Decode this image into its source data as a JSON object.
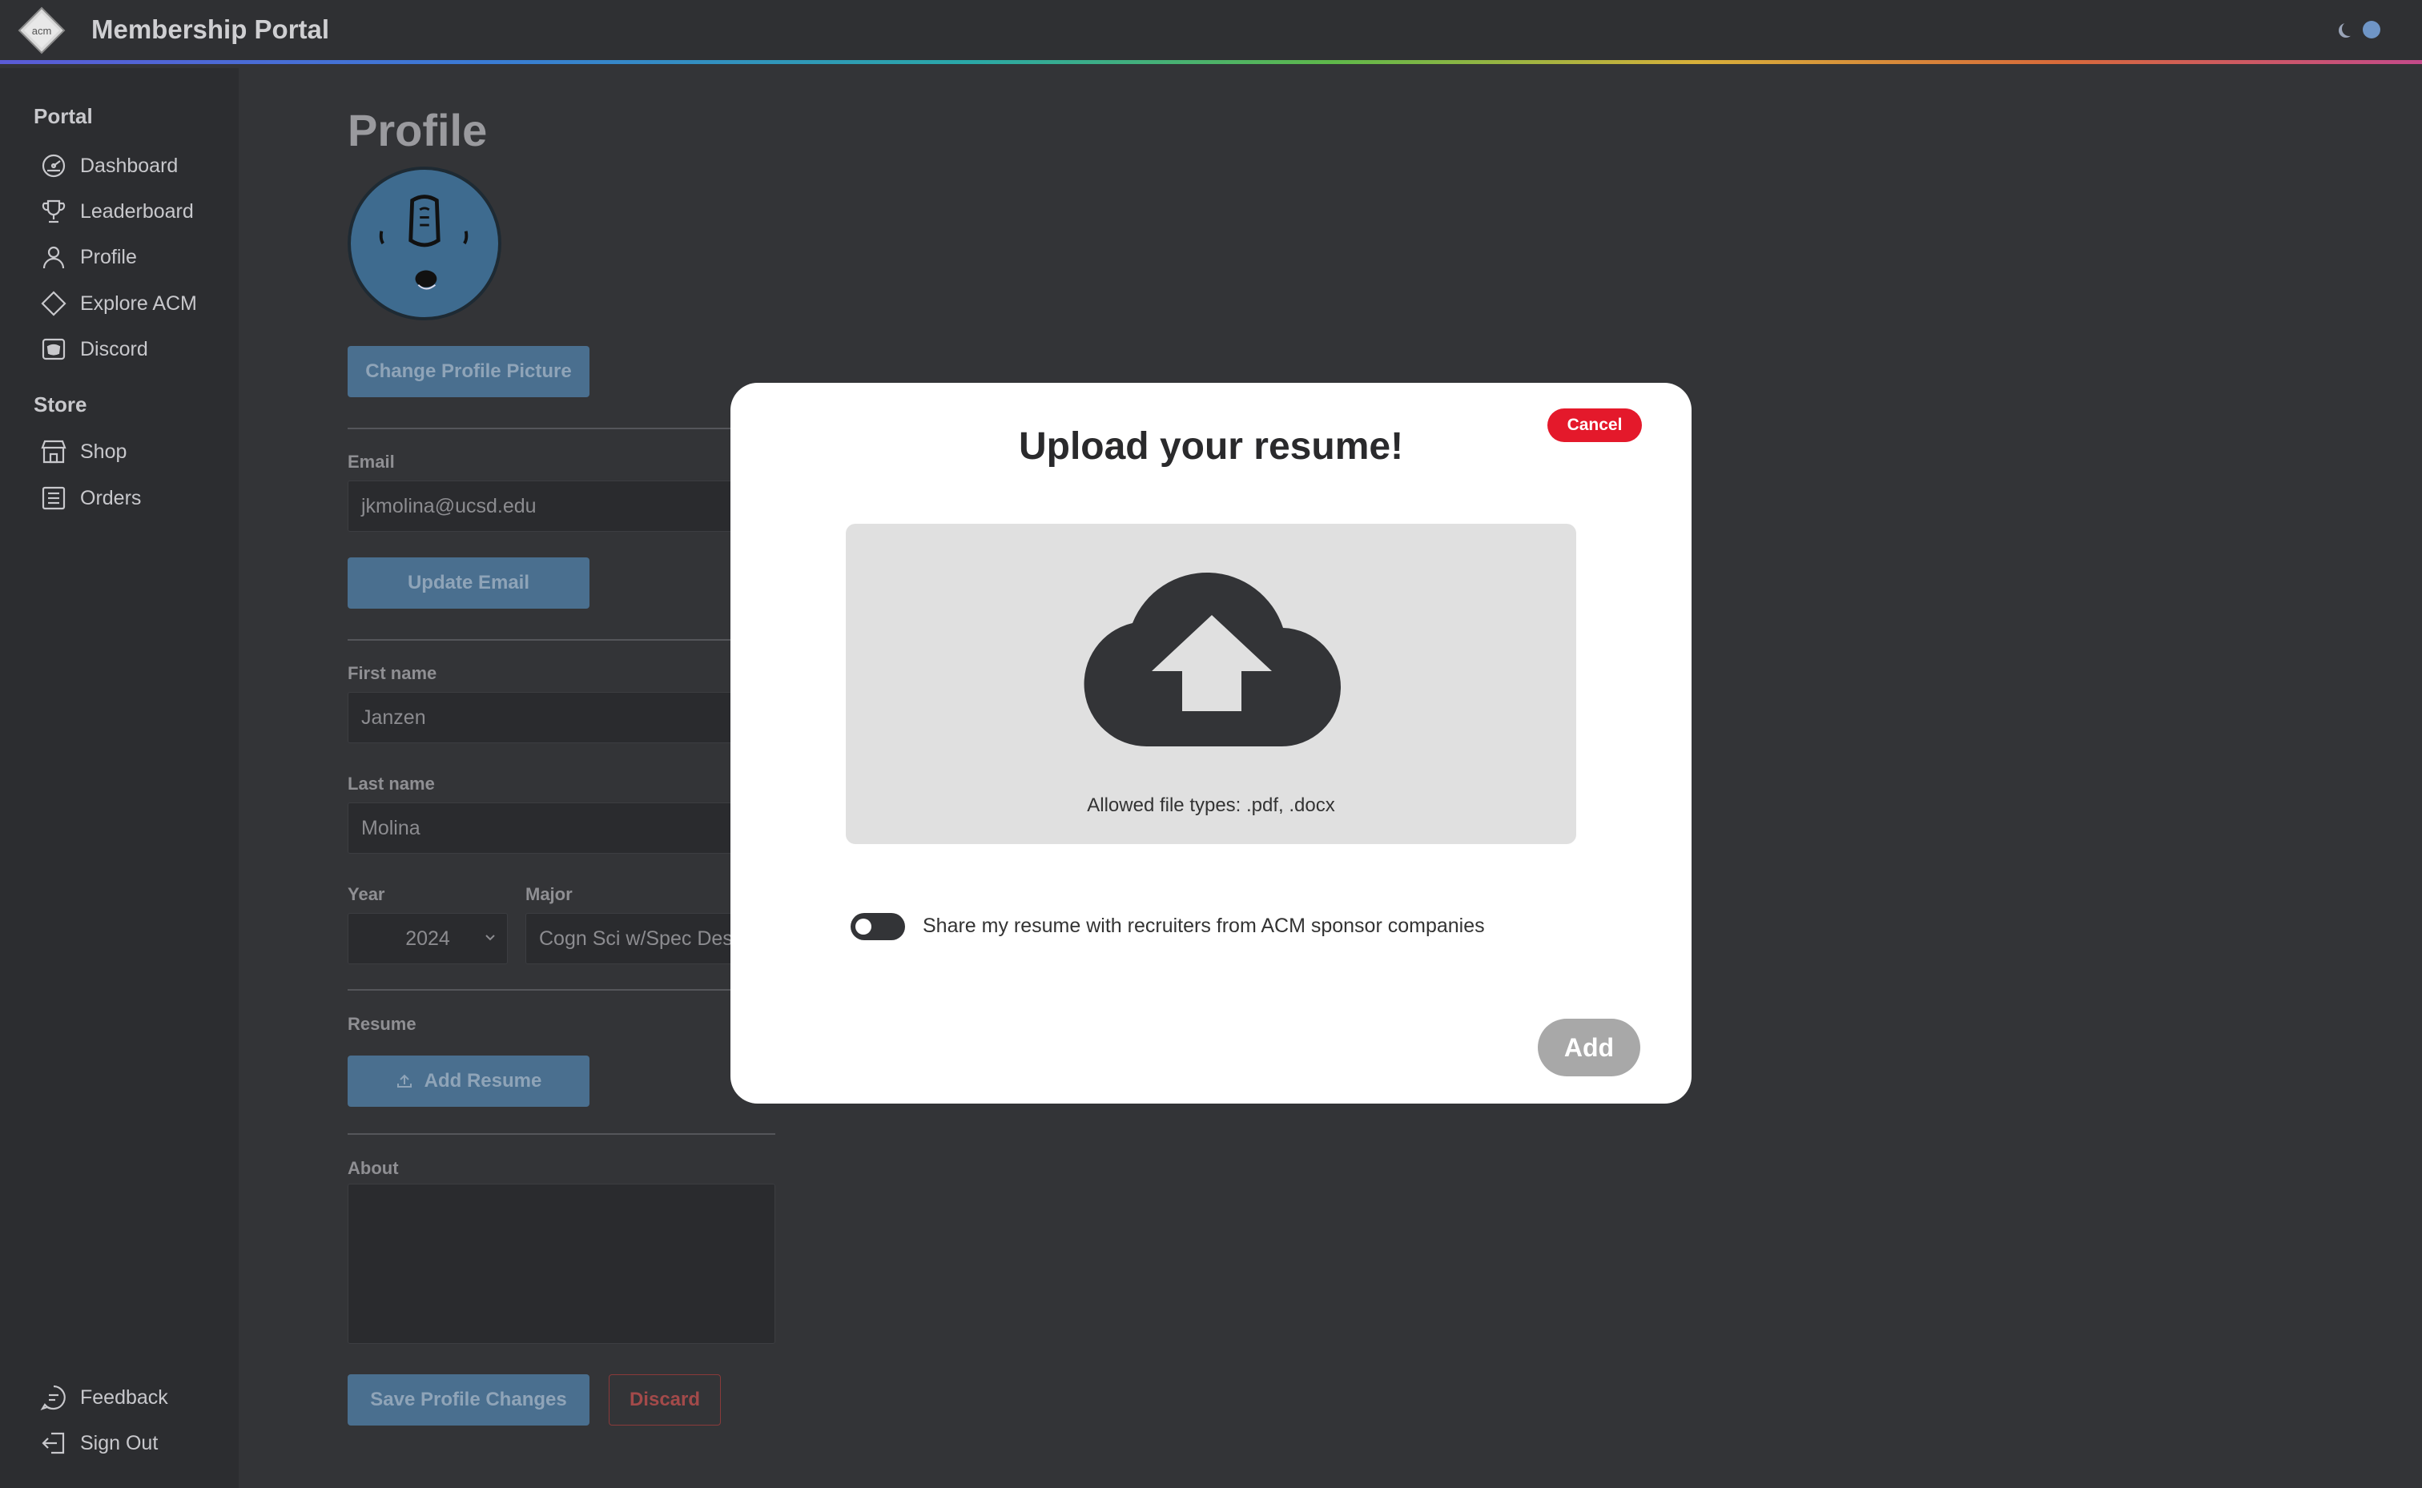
{
  "header": {
    "title": "Membership Portal",
    "logo_text": "acm"
  },
  "sidebar": {
    "portal_heading": "Portal",
    "portal_items": [
      {
        "label": "Dashboard",
        "icon": "dashboard-gauge-icon"
      },
      {
        "label": "Leaderboard",
        "icon": "trophy-icon"
      },
      {
        "label": "Profile",
        "icon": "user-icon"
      },
      {
        "label": "Explore ACM",
        "icon": "diamond-icon"
      },
      {
        "label": "Discord",
        "icon": "discord-icon"
      }
    ],
    "store_heading": "Store",
    "store_items": [
      {
        "label": "Shop",
        "icon": "storefront-icon"
      },
      {
        "label": "Orders",
        "icon": "list-icon"
      }
    ],
    "bottom_items": [
      {
        "label": "Feedback",
        "icon": "feedback-icon"
      },
      {
        "label": "Sign Out",
        "icon": "sign-out-icon"
      }
    ]
  },
  "profile": {
    "title": "Profile",
    "change_picture_label": "Change Profile Picture",
    "email_label": "Email",
    "email_value": "jkmolina@ucsd.edu",
    "update_email_label": "Update Email",
    "first_name_label": "First name",
    "first_name_value": "Janzen",
    "last_name_label": "Last name",
    "last_name_value": "Molina",
    "year_label": "Year",
    "year_value": "2024",
    "major_label": "Major",
    "major_value": "Cogn Sci w/Spec Desi",
    "resume_label": "Resume",
    "add_resume_label": "Add Resume",
    "about_label": "About",
    "save_label": "Save Profile Changes",
    "discard_label": "Discard"
  },
  "modal": {
    "title": "Upload your resume!",
    "cancel_label": "Cancel",
    "allowed_types": "Allowed file types: .pdf, .docx",
    "share_label": "Share my resume with recruiters from ACM sponsor companies",
    "share_enabled": false,
    "add_label": "Add"
  },
  "colors": {
    "background": "#333437",
    "sidebar": "#2c2d30",
    "accent_button": "#4a6f8f",
    "cancel_red": "#e4192b",
    "add_disabled": "#a8a8a8"
  }
}
